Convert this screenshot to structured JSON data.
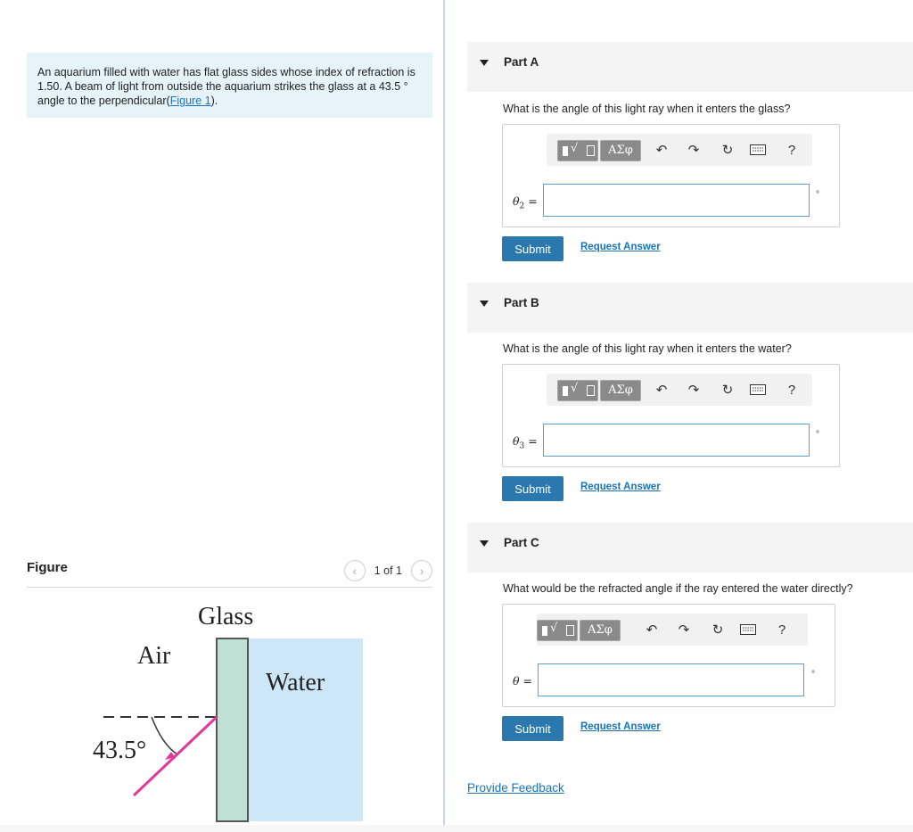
{
  "problem": {
    "text": "An aquarium filled with water has flat glass sides whose index of refraction is 1.50. A beam of light from outside the aquarium strikes the glass at a 43.5 ° angle to the perpendicular(",
    "link": "Figure 1",
    "after": ")."
  },
  "figure": {
    "title": "Figure",
    "pager_text": "1 of 1",
    "prev_icon": "chevron-left",
    "next_icon": "chevron-right",
    "labels": {
      "glass": "Glass",
      "air": "Air",
      "water": "Water",
      "angle": "43.5°"
    },
    "colors": {
      "glass": "#bfe0d5",
      "water": "#cde6f8",
      "ray": "#e0399a"
    }
  },
  "toolbar": {
    "greek_label": "ΑΣφ",
    "help_label": "?",
    "icons": [
      "template-icon",
      "greek-icon",
      "undo-icon",
      "redo-icon",
      "reset-icon",
      "keyboard-icon",
      "help-icon"
    ]
  },
  "parts": [
    {
      "label": "Part A",
      "question": "What is the angle of this light ray when it enters the glass?",
      "var": "θ",
      "sub": "2",
      "unit": "°",
      "value": "",
      "submit": "Submit",
      "request": "Request Answer"
    },
    {
      "label": "Part B",
      "question": "What is the angle of this light ray when it enters the water?",
      "var": "θ",
      "sub": "3",
      "unit": "°",
      "value": "",
      "submit": "Submit",
      "request": "Request Answer"
    },
    {
      "label": "Part C",
      "question": "What would be the refracted angle if the ray entered the water directly?",
      "var": "θ",
      "sub": "",
      "unit": "°",
      "value": "",
      "submit": "Submit",
      "request": "Request Answer"
    }
  ],
  "feedback": "Provide Feedback",
  "colors": {
    "accent": "#2a78ad",
    "link": "#1a73b8",
    "input_border": "#5aa1d8",
    "problem_bg": "#e6f3f8"
  }
}
